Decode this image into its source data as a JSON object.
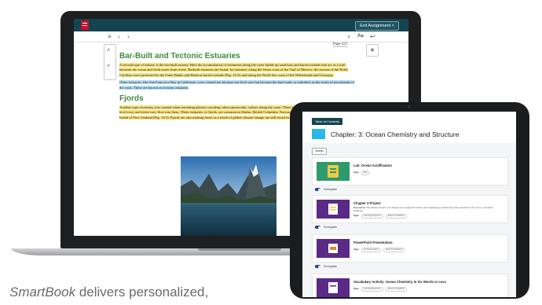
{
  "laptop": {
    "exit_button": "Exit Assignment",
    "aa_label": "Aa",
    "page_label": "Page 421",
    "heading1": "Bar-Built and Tectonic Estuaries",
    "para1_hl": "A second type of estuary is the bar-built estuary. Here the accumulation of sediments along the coast builds up sand bars and barrier islands that act as a wall between the ocean and fresh water from rivers. Barbuilt estuaries are found, for instance, along the Texas coast of the Gulf of Mexico, the section of the North Carolina coast protected by the Outer Banks and Hatteras barrier islands (",
    "para1_tail": "Fig. 14.3), and along the North Sea coast of the Netherlands and Germany.",
    "para2": "Other estuaries, like San Francisco Bay in California, were created not because sea level rose but because the land sank, or subsided, as the result of movements of the crust. These are known as tectonic estuaries.",
    "heading2": "Fjords",
    "para3": "Another type of estuary was created when retreating glaciers cut deep, often spectacular, valleys along the coast. These valleys were partially submerged when sea level rose, and rivers now flow into them. These estuaries, or fjords, are common in Alaska, British Columbia, Norway, Greenland, southern Chile, and the South Island of New Zealand (Fig. 14.4). Fjords are also melting faster as a result of global climate change are still found in many fjords, particularly in Alaska."
  },
  "tablet": {
    "toc_button": "Table of Contents",
    "chapter_title": "Chapter: 3: Ocean Chemistry and Structure",
    "assign_tag": "Assign",
    "cards": [
      {
        "title": "Lab: Ocean Acidification",
        "type_label": "Type",
        "chips": [
          "App"
        ],
        "toggle": "Prerequisite"
      },
      {
        "title": "Chapter 3 Project",
        "desc_label": "Description",
        "desc": "The Chapter Project is an assessment to apply the science and engineering practices they have acquired in the unit to a real-world challenge.",
        "type_label": "Type",
        "chips": [
          "Learning Resource",
          "Ideas for Students"
        ],
        "toggle": "Prerequisite"
      },
      {
        "title": "PowerPoint Presentation",
        "type_label": "Type",
        "chips": [
          "For Presentation",
          "Ideas for Students"
        ],
        "toggle": "Prerequisite"
      },
      {
        "title": "Vocabulary Activity: Ocean Chemistry in Six Words or Less",
        "type_label": "Type",
        "chips": [
          "Learning Resource",
          "Ideas for Students"
        ],
        "toggle": "Prerequisite"
      }
    ]
  },
  "caption": {
    "italic": "SmartBook",
    "rest": " delivers personalized,"
  },
  "colors": {
    "app_bar": "#134451",
    "accent_cyan": "#2ab7ea",
    "highlight_yellow": "#f8e27a",
    "highlight_blue": "#b7dcf4",
    "heading_green": "#3d8a36"
  }
}
